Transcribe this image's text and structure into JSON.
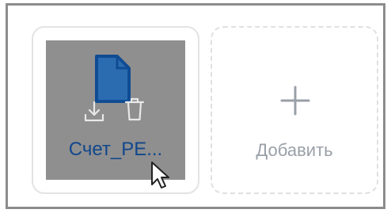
{
  "attachments": {
    "files": [
      {
        "name": "Счет_РЕ...",
        "type_icon": "file-icon",
        "actions": [
          "download-icon",
          "trash-icon"
        ]
      }
    ],
    "add_button": {
      "label": "Добавить",
      "icon": "plus-icon"
    }
  },
  "colors": {
    "file_name": "#11478c",
    "preview_overlay": "#8f8f8f",
    "add_label": "#9aa0a8",
    "card_border": "#e3e3e6",
    "frame_border": "#8c8c8c"
  },
  "cursor": {
    "icon": "cursor-arrow-icon"
  }
}
